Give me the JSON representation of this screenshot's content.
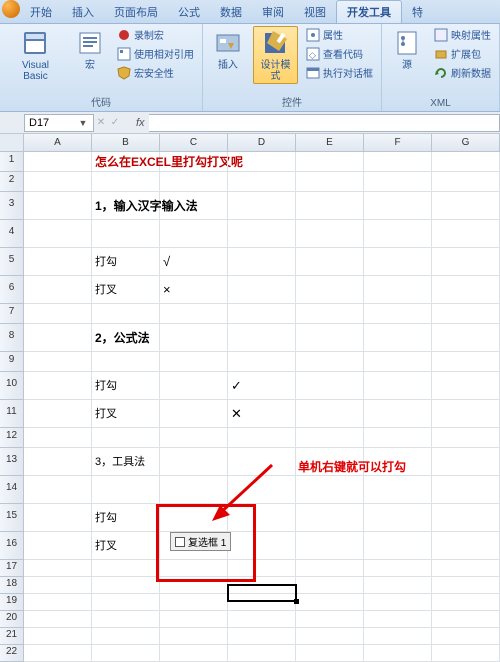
{
  "tabs": {
    "items": [
      "开始",
      "插入",
      "页面布局",
      "公式",
      "数据",
      "审阅",
      "视图",
      "开发工具",
      "特"
    ],
    "active_index": 7
  },
  "ribbon": {
    "groups": {
      "code": {
        "label": "代码",
        "vb": "Visual Basic",
        "macro": "宏",
        "record": "录制宏",
        "relative": "使用相对引用",
        "security": "宏安全性"
      },
      "controls": {
        "label": "控件",
        "insert": "插入",
        "design": "设计模式",
        "properties": "属性",
        "viewcode": "查看代码",
        "rundialog": "执行对话框"
      },
      "xml": {
        "label": "XML",
        "source": "源",
        "mapprops": "映射属性",
        "expand": "扩展包",
        "refresh": "刷新数据"
      }
    }
  },
  "namebox": "D17",
  "columns": [
    "A",
    "B",
    "C",
    "D",
    "E",
    "F",
    "G"
  ],
  "row_heights": [
    "norm",
    "norm",
    "tall",
    "tall",
    "tall",
    "tall",
    "norm",
    "tall",
    "norm",
    "tall",
    "tall",
    "norm",
    "tall",
    "tall",
    "tall",
    "tall",
    "short",
    "short",
    "short",
    "short",
    "short",
    "short"
  ],
  "cells": {
    "title": "怎么在EXCEL里打勾打叉呢",
    "m1": "1，输入汉字输入法",
    "tick_label": "打勾",
    "cross_label": "打叉",
    "tick1": "√",
    "cross1": "×",
    "m2": "2，公式法",
    "tick2": "✓",
    "cross2": "✕",
    "m3": "3，工具法",
    "checkbox_text": "复选框 1",
    "note": "单机右键就可以打勾"
  }
}
